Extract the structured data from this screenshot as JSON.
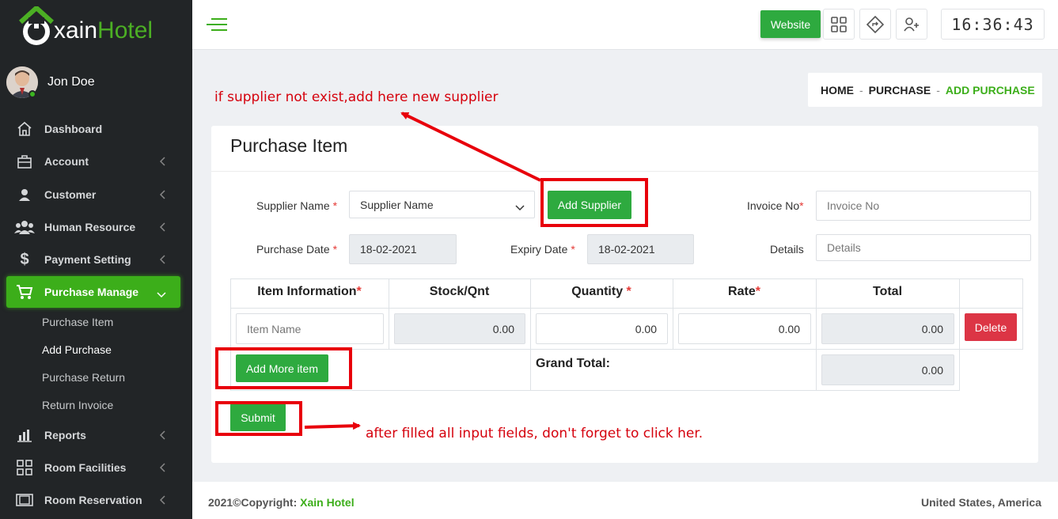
{
  "app": {
    "logo_part1": "xain",
    "logo_part2": "Hotel"
  },
  "user": {
    "name": "Jon Doe"
  },
  "sidebar": {
    "items": [
      {
        "label": "Dashboard",
        "icon": "home-icon"
      },
      {
        "label": "Account",
        "icon": "briefcase-icon"
      },
      {
        "label": "Customer",
        "icon": "user-icon"
      },
      {
        "label": "Human Resource",
        "icon": "users-icon"
      },
      {
        "label": "Payment Setting",
        "icon": "dollar-icon"
      },
      {
        "label": "Purchase Manage",
        "icon": "cart-icon"
      },
      {
        "label": "Reports",
        "icon": "bar-chart-icon"
      },
      {
        "label": "Room Facilities",
        "icon": "grid-icon"
      },
      {
        "label": "Room Reservation",
        "icon": "film-icon"
      }
    ],
    "sub_items": [
      "Purchase Item",
      "Add Purchase",
      "Purchase Return",
      "Return Invoice"
    ]
  },
  "topbar": {
    "website_label": "Website",
    "clock": "16:36:43"
  },
  "breadcrumb": {
    "home": "HOME",
    "section": "PURCHASE",
    "current": "ADD PURCHASE",
    "sep": "-"
  },
  "form": {
    "title": "Purchase Item",
    "supplier_label": "Supplier Name",
    "supplier_value": "Supplier Name",
    "add_supplier": "Add Supplier",
    "invoice_label": "Invoice No",
    "invoice_placeholder": "Invoice No",
    "purchase_date_label": "Purchase Date",
    "purchase_date": "18-02-2021",
    "expiry_date_label": "Expiry Date",
    "expiry_date": "18-02-2021",
    "details_label": "Details",
    "details_placeholder": "Details",
    "req": "*"
  },
  "table": {
    "headers": [
      "Item Information",
      "Stock/Qnt",
      "Quantity",
      "Rate",
      "Total"
    ],
    "item_placeholder": "Item Name",
    "stock": "0.00",
    "quantity": "0.00",
    "rate": "0.00",
    "total": "0.00",
    "delete_label": "Delete",
    "add_more": "Add More item",
    "grand_total_label": "Grand Total:",
    "grand_total": "0.00"
  },
  "submit_label": "Submit",
  "annotations": {
    "supplier": "if supplier not exist,add here new supplier",
    "submit": "after filled all input fields, don't forget to click her."
  },
  "footer": {
    "copyright": "2021©Copyright: ",
    "brand": "Xain Hotel",
    "region": "United States, America"
  },
  "colors": {
    "brand_green": "#3cae1a",
    "sidebar_bg": "#222527",
    "danger": "#dc3545",
    "annotation_red": "#e8000b"
  }
}
